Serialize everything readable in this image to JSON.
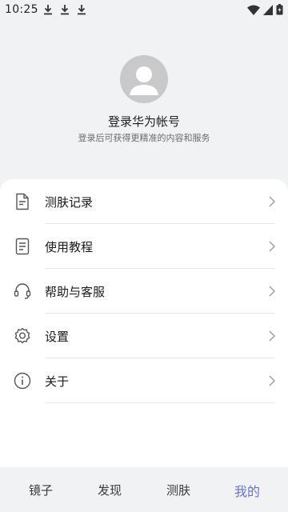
{
  "status_bar": {
    "time": "10:25",
    "left_icons": [
      "download-icon",
      "download-icon",
      "download-icon"
    ],
    "right_icons": [
      "wifi-icon",
      "cellular-signal-icon",
      "battery-icon"
    ]
  },
  "profile": {
    "avatar_icon": "default-avatar-icon",
    "title": "登录华为帐号",
    "subtitle": "登录后可获得更精准的内容和服务"
  },
  "menu": {
    "items": [
      {
        "label": "测肤记录",
        "icon": "document-icon"
      },
      {
        "label": "使用教程",
        "icon": "notes-icon"
      },
      {
        "label": "帮助与客服",
        "icon": "headset-icon"
      },
      {
        "label": "设置",
        "icon": "gear-icon"
      },
      {
        "label": "关于",
        "icon": "info-icon"
      }
    ]
  },
  "bottom_nav": {
    "tabs": [
      {
        "label": "镜子",
        "active": false
      },
      {
        "label": "发现",
        "active": false
      },
      {
        "label": "测肤",
        "active": false
      },
      {
        "label": "我的",
        "active": true
      }
    ],
    "accent_color": "#6a72d8"
  },
  "colors": {
    "background": "#f1f2f4",
    "card": "#ffffff",
    "avatar": "#c9c9cb"
  }
}
